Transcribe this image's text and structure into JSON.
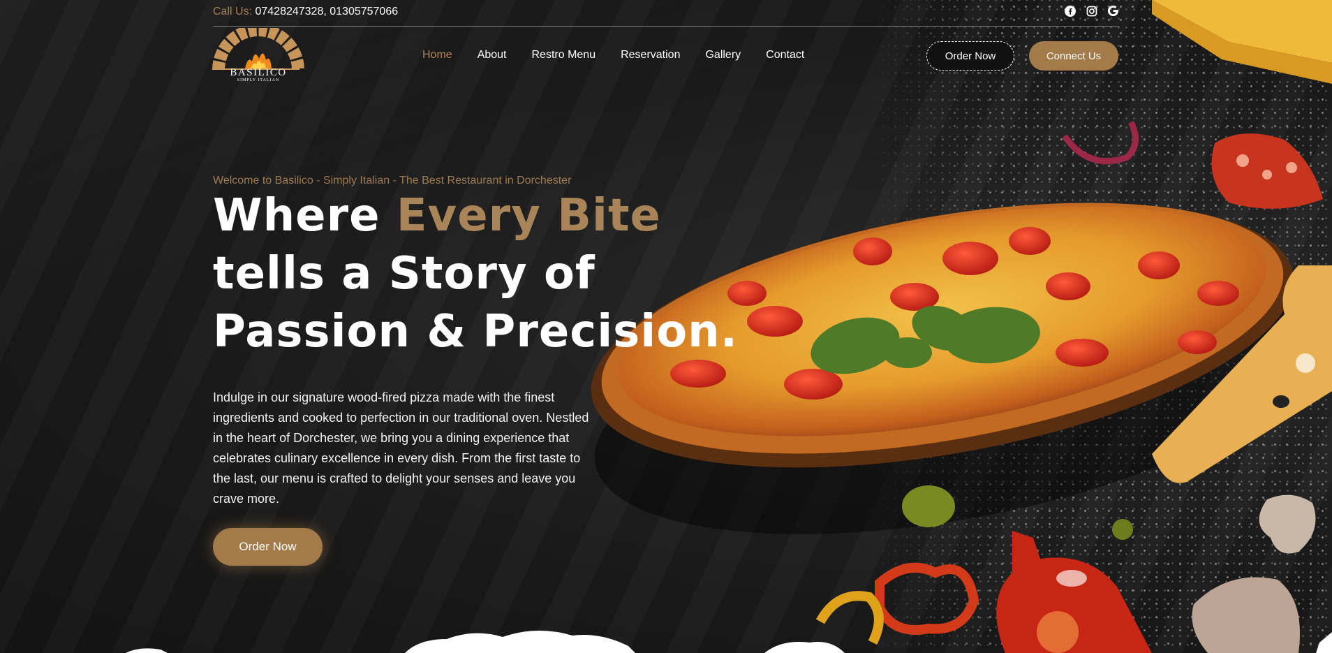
{
  "topbar": {
    "call_label": "Call Us:",
    "phones": "07428247328, 01305757066",
    "socials": [
      "facebook-icon",
      "instagram-icon",
      "google-icon"
    ]
  },
  "brand": {
    "name": "BASILICO",
    "tagline": "SIMPLY ITALIAN"
  },
  "nav": {
    "items": [
      "Home",
      "About",
      "Restro Menu",
      "Reservation",
      "Gallery",
      "Contact"
    ],
    "active": "Home"
  },
  "header_buttons": {
    "order": "Order Now",
    "connect": "Connect Us"
  },
  "hero": {
    "eyebrow": "Welcome to Basilico - Simply Italian - The Best Restaurant in Dorchester",
    "title_part1": "Where ",
    "title_accent": "Every Bite",
    "title_part2": " tells a Story of Passion & Precision.",
    "description": "Indulge in our signature wood-fired pizza made with the finest ingredients and cooked to perfection in our traditional oven. Nestled in the heart of Dorchester, we bring you a dining experience that celebrates culinary excellence in every dish. From the first taste to the last, our menu is crafted to delight your senses and leave you crave more.",
    "cta": "Order Now"
  },
  "colors": {
    "accent": "#a47a48",
    "background": "#1c1c1c",
    "text": "#ffffff"
  }
}
